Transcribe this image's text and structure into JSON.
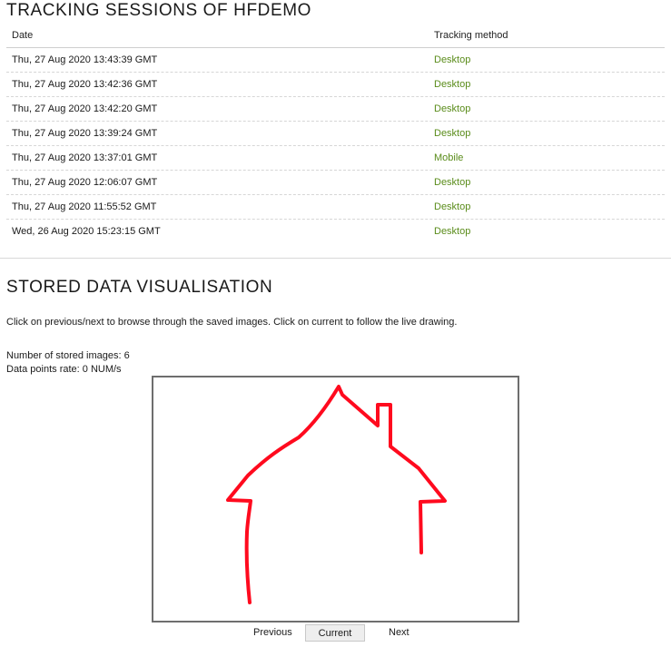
{
  "tracking": {
    "title": "TRACKING SESSIONS OF HFDEMO",
    "headers": {
      "date": "Date",
      "method": "Tracking method"
    },
    "rows": [
      {
        "date": "Thu, 27 Aug 2020 13:43:39 GMT",
        "method": "Desktop"
      },
      {
        "date": "Thu, 27 Aug 2020 13:42:36 GMT",
        "method": "Desktop"
      },
      {
        "date": "Thu, 27 Aug 2020 13:42:20 GMT",
        "method": "Desktop"
      },
      {
        "date": "Thu, 27 Aug 2020 13:39:24 GMT",
        "method": "Desktop"
      },
      {
        "date": "Thu, 27 Aug 2020 13:37:01 GMT",
        "method": "Mobile"
      },
      {
        "date": "Thu, 27 Aug 2020 12:06:07 GMT",
        "method": "Desktop"
      },
      {
        "date": "Thu, 27 Aug 2020 11:55:52 GMT",
        "method": "Desktop"
      },
      {
        "date": "Wed, 26 Aug 2020 15:23:15 GMT",
        "method": "Desktop"
      }
    ]
  },
  "visualisation": {
    "title": "STORED DATA VISUALISATION",
    "instructions": "Click on previous/next to browse through the saved images. Click on current to follow the live drawing.",
    "stored_images": "Number of stored images: 6",
    "data_rate": "Data points rate: 0 NUM/s",
    "drawing_color": "#ff0a1e",
    "nav": {
      "previous": "Previous",
      "current": "Current",
      "next": "Next"
    }
  },
  "colors": {
    "link_green": "#5a8c1a",
    "canvas_border": "#6e6e6e"
  }
}
